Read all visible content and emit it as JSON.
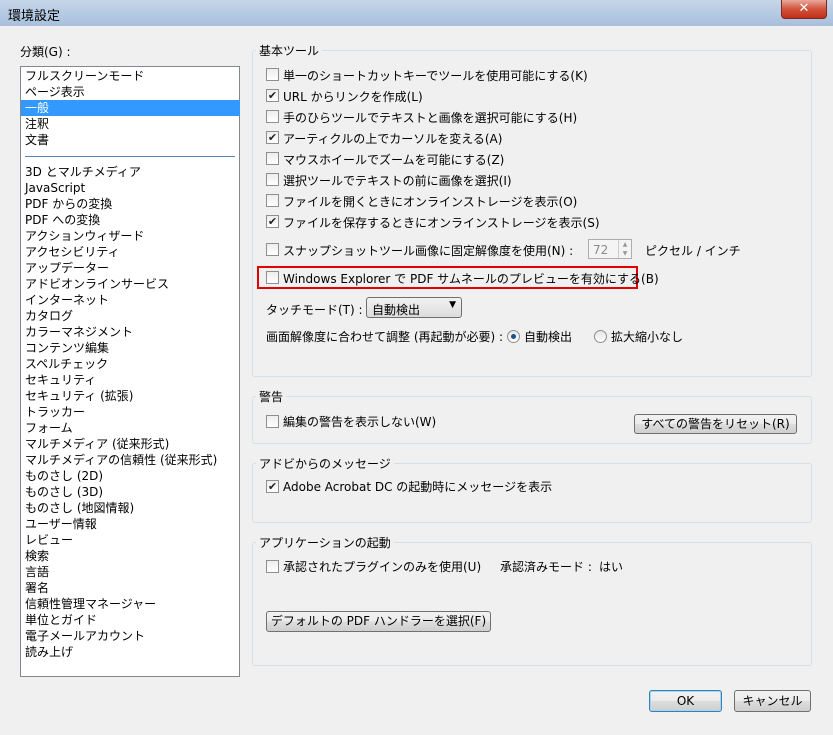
{
  "window": {
    "title": "環境設定",
    "close_glyph": "✕"
  },
  "categories": {
    "label": "分類(G) :",
    "top_items": [
      "フルスクリーンモード",
      "ページ表示",
      "一般",
      "注釈",
      "文書"
    ],
    "selected": "一般",
    "items": [
      "3D とマルチメディア",
      "JavaScript",
      "PDF からの変換",
      "PDF への変換",
      "アクションウィザード",
      "アクセシビリティ",
      "アップデーター",
      "アドビオンラインサービス",
      "インターネット",
      "カタログ",
      "カラーマネジメント",
      "コンテンツ編集",
      "スペルチェック",
      "セキュリティ",
      "セキュリティ (拡張)",
      "トラッカー",
      "フォーム",
      "マルチメディア (従来形式)",
      "マルチメディアの信頼性 (従来形式)",
      "ものさし (2D)",
      "ものさし (3D)",
      "ものさし (地図情報)",
      "ユーザー情報",
      "レビュー",
      "検索",
      "言語",
      "署名",
      "信頼性管理マネージャー",
      "単位とガイド",
      "電子メールアカウント",
      "読み上げ"
    ]
  },
  "basic_tools": {
    "title": "基本ツール",
    "options": [
      {
        "label": "単一のショートカットキーでツールを使用可能にする(K)",
        "checked": false
      },
      {
        "label": "URL からリンクを作成(L)",
        "checked": true
      },
      {
        "label": "手のひらツールでテキストと画像を選択可能にする(H)",
        "checked": false
      },
      {
        "label": "アーティクルの上でカーソルを変える(A)",
        "checked": true
      },
      {
        "label": "マウスホイールでズームを可能にする(Z)",
        "checked": false
      },
      {
        "label": "選択ツールでテキストの前に画像を選択(I)",
        "checked": false
      },
      {
        "label": "ファイルを開くときにオンラインストレージを表示(O)",
        "checked": false
      },
      {
        "label": "ファイルを保存するときにオンラインストレージを表示(S)",
        "checked": true
      }
    ],
    "snapshot": {
      "label": "スナップショットツール画像に固定解像度を使用(N) :",
      "checked": false,
      "value": "72",
      "unit": "ピクセル / インチ"
    },
    "explorer": {
      "label": "Windows Explorer で PDF サムネールのプレビューを有効にする(B)",
      "checked": false
    },
    "touch": {
      "label": "タッチモード(T) :",
      "value": "自動検出"
    },
    "scaling": {
      "label": "画面解像度に合わせて調整 (再起動が必要) :",
      "options": [
        "自動検出",
        "拡大縮小なし"
      ],
      "selected": "自動検出"
    }
  },
  "warnings": {
    "title": "警告",
    "option": {
      "label": "編集の警告を表示しない(W)",
      "checked": false
    },
    "reset_button": "すべての警告をリセット(R)"
  },
  "messages": {
    "title": "アドビからのメッセージ",
    "option": {
      "label": "Adobe Acrobat DC の起動時にメッセージを表示",
      "checked": true
    }
  },
  "startup": {
    "title": "アプリケーションの起動",
    "option": {
      "label": "承認されたプラグインのみを使用(U)",
      "checked": false
    },
    "mode_label": "承認済みモード :",
    "mode_value": "はい",
    "handler_button": "デフォルトの PDF ハンドラーを選択(F)"
  },
  "footer": {
    "ok": "OK",
    "cancel": "キャンセル"
  },
  "colors": {
    "selection": "#3399ff",
    "highlight": "#e30000",
    "titlebar": "#b3c8e2"
  }
}
